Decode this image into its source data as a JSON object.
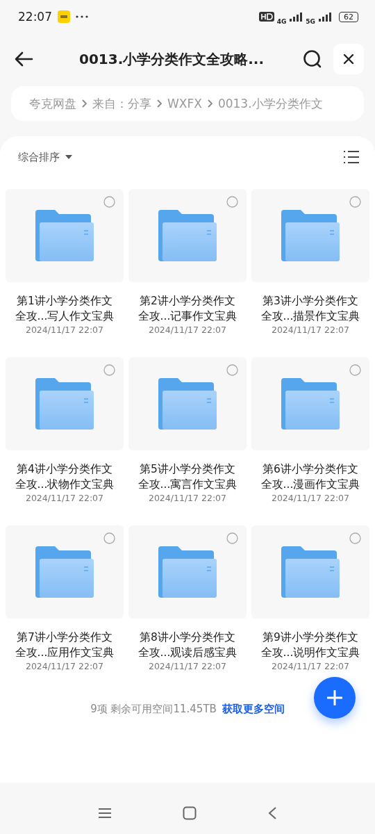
{
  "status_bar": {
    "time": "22:07",
    "network_1": "4G",
    "network_2": "5G",
    "battery": "62"
  },
  "header": {
    "title": "0013.小学分类作文全攻略..."
  },
  "breadcrumb": [
    "夸克网盘",
    "来自：分享",
    "WXFX",
    "0013.小学分类作文"
  ],
  "sort": {
    "label": "综合排序"
  },
  "files": [
    {
      "name": "第1讲小学分类作文全攻...写人作文宝典",
      "date": "2024/11/17 22:07",
      "selected": false
    },
    {
      "name": "第2讲小学分类作文全攻...记事作文宝典",
      "date": "2024/11/17 22:07",
      "selected": false
    },
    {
      "name": "第3讲小学分类作文全攻...描景作文宝典",
      "date": "2024/11/17 22:07",
      "selected": false
    },
    {
      "name": "第4讲小学分类作文全攻...状物作文宝典",
      "date": "2024/11/17 22:07",
      "selected": false
    },
    {
      "name": "第5讲小学分类作文全攻...寓言作文宝典",
      "date": "2024/11/17 22:07",
      "selected": false
    },
    {
      "name": "第6讲小学分类作文全攻...漫画作文宝典",
      "date": "2024/11/17 22:07",
      "selected": false
    },
    {
      "name": "第7讲小学分类作文全攻...应用作文宝典",
      "date": "2024/11/17 22:07",
      "selected": false
    },
    {
      "name": "第8讲小学分类作文全攻...观读后感宝典",
      "date": "2024/11/17 22:07",
      "selected": false
    },
    {
      "name": "第9讲小学分类作文全攻...说明作文宝典",
      "date": "2024/11/17 22:07",
      "selected": false
    }
  ],
  "footer": {
    "summary": "9项 剩余可用空间11.45TB",
    "link": "获取更多空间"
  }
}
